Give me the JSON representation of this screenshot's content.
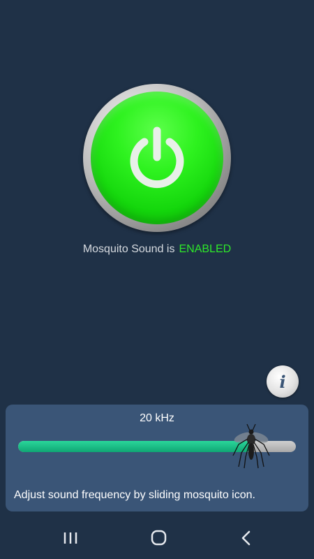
{
  "power": {
    "state": "enabled"
  },
  "status": {
    "prefix": "Mosquito Sound is",
    "state_label": "ENABLED"
  },
  "info": {
    "glyph": "i"
  },
  "frequency": {
    "label": "20 kHz",
    "slider_fraction": 0.84,
    "hint": "Adjust sound frequency by sliding mosquito icon."
  },
  "nav": {
    "icons": [
      "recent-apps-icon",
      "home-icon",
      "back-icon"
    ]
  },
  "colors": {
    "background": "#1f3147",
    "panel": "#3a5577",
    "accent_green": "#2ee829",
    "slider_fill": "#10a774"
  }
}
